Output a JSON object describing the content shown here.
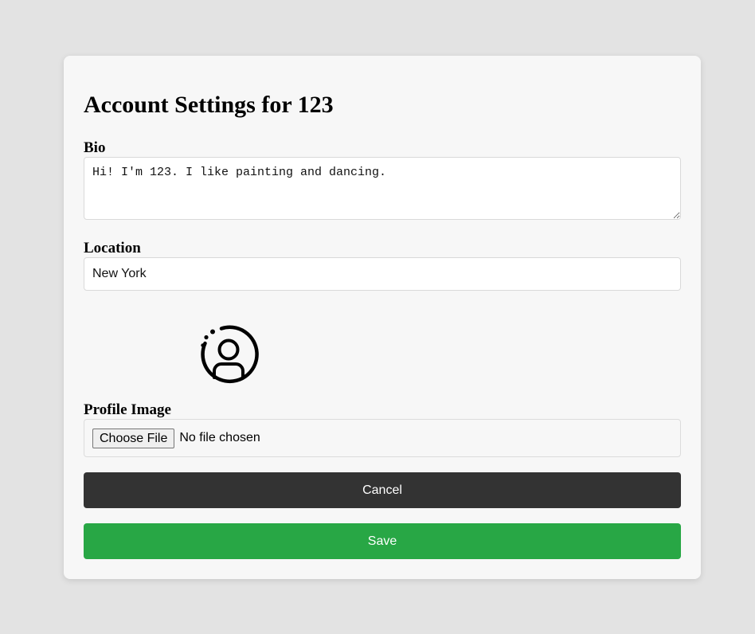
{
  "page": {
    "title": "Account Settings for 123"
  },
  "bio": {
    "label": "Bio",
    "value": "Hi! I'm 123. I like painting and dancing."
  },
  "location": {
    "label": "Location",
    "value": "New York"
  },
  "profile_image": {
    "avatar_icon": "user-circle-icon",
    "label": "Profile Image",
    "choose_label": "Choose File",
    "status": "No file chosen"
  },
  "actions": {
    "cancel_label": "Cancel",
    "save_label": "Save"
  },
  "colors": {
    "background": "#e3e3e3",
    "card": "#f7f7f7",
    "cancel_button": "#333333",
    "save_button": "#28a745"
  }
}
